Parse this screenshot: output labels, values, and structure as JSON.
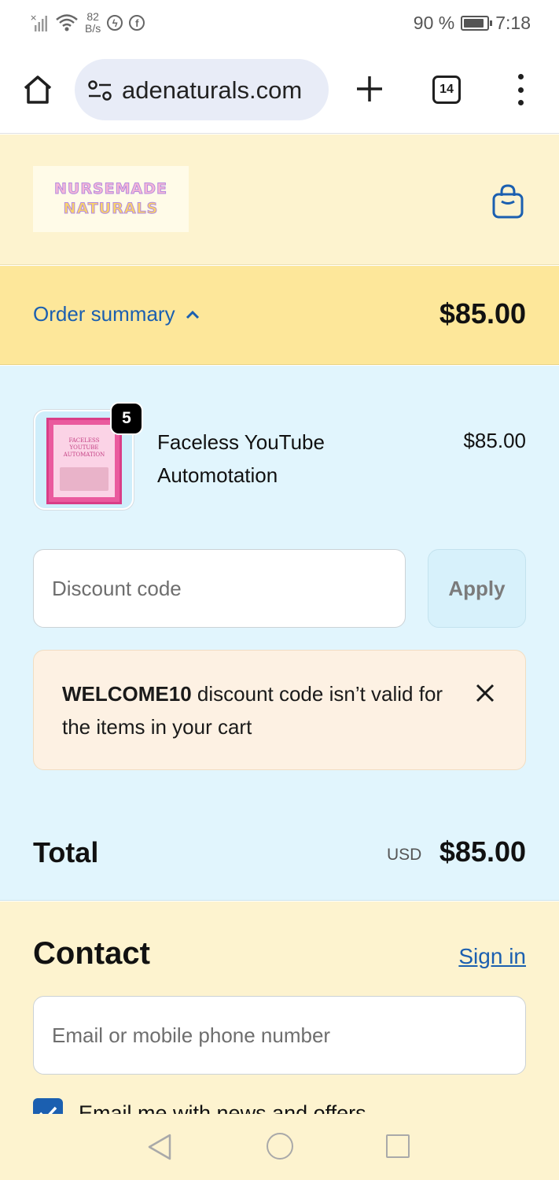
{
  "status_bar": {
    "network_speed_value": "82",
    "network_speed_unit": "B/s",
    "battery_percent": "90 %",
    "battery_level": 0.9,
    "time": "7:18",
    "icons": [
      "signal-icon",
      "wifi-icon",
      "messenger-icon",
      "facebook-icon",
      "battery-icon"
    ]
  },
  "browser": {
    "url": "adenaturals.com",
    "tab_count": "14"
  },
  "shop": {
    "logo_line1": "NURSEMADE",
    "logo_line2": "NATURALS"
  },
  "order_summary": {
    "toggle_label": "Order summary",
    "total": "$85.00"
  },
  "cart": {
    "items": [
      {
        "name": "Faceless YouTube Automotation",
        "price": "$85.00",
        "quantity": "5",
        "thumbnail_title": "FACELESS YOUTUBE AUTOMATION"
      }
    ],
    "discount": {
      "placeholder": "Discount code",
      "apply_label": "Apply"
    },
    "alert": {
      "code": "WELCOME10",
      "message": " discount code isn’t valid for the items in your cart"
    },
    "total_label": "Total",
    "total_currency": "USD",
    "total_amount": "$85.00"
  },
  "contact": {
    "title": "Contact",
    "sign_in_label": "Sign in",
    "email_placeholder": "Email or mobile phone number",
    "newsletter_label": "Email me with news and offers",
    "newsletter_checked": true
  },
  "colors": {
    "accent": "#1b5fb0",
    "header_bg": "#fdf3cf",
    "summary_bg": "#fde79a",
    "cart_bg": "#e1f5fd",
    "alert_bg": "#fdf1e3"
  }
}
